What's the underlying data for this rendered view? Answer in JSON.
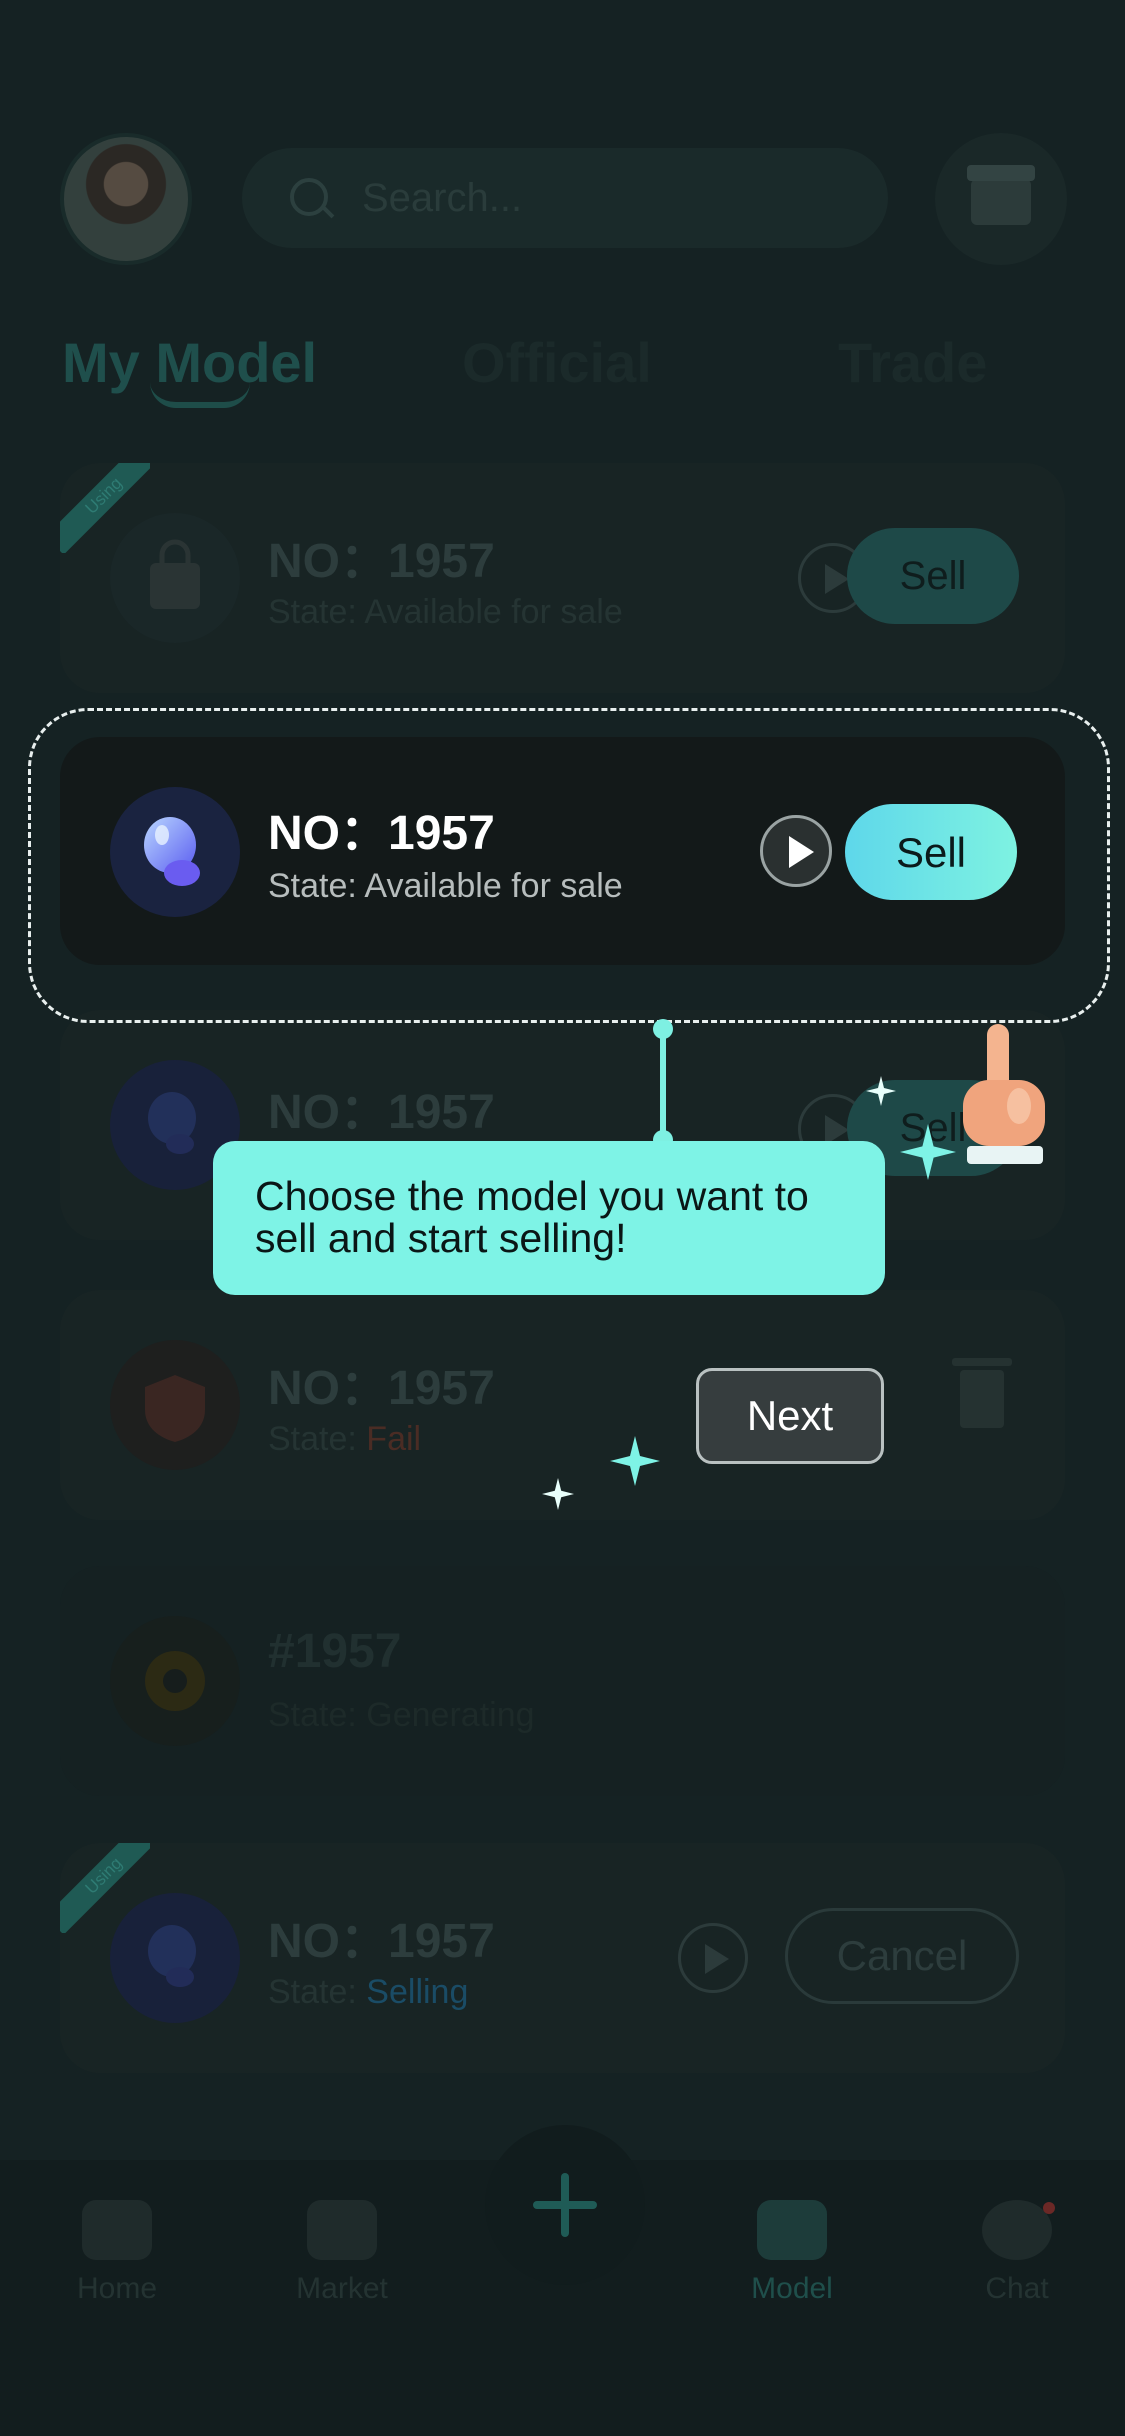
{
  "header": {
    "search_placeholder": "Search..."
  },
  "tabs": [
    {
      "label": "My Model"
    },
    {
      "label": "Official"
    },
    {
      "label": "Trade"
    }
  ],
  "cards": [
    {
      "badge": "Using",
      "number": "NO：1957",
      "state_prefix": "State:",
      "state_value": "Available for sale",
      "action": "Sell"
    },
    {
      "number": "NO：1957",
      "state_prefix": "State:",
      "state_value": "Available for sale",
      "action": "Sell"
    },
    {
      "number": "NO：1957",
      "action": "Sell"
    },
    {
      "number": "NO：1957",
      "state_prefix": "State:",
      "state_value": "Fail"
    },
    {
      "number": "#1957",
      "state_prefix": "State:",
      "state_value": "Generating"
    },
    {
      "badge": "Using",
      "number": "NO：1957",
      "state_prefix": "State:",
      "state_value": "Selling",
      "action": "Cancel"
    }
  ],
  "highlight": {
    "number": "NO：1957",
    "state": "State: Available for sale",
    "action": "Sell"
  },
  "tooltip": {
    "text": "Choose the model you want to sell and start selling!",
    "next_label": "Next"
  },
  "bottom_nav": [
    {
      "label": "Home"
    },
    {
      "label": "Market"
    },
    {
      "label": "Model",
      "active": true
    },
    {
      "label": "Chat"
    }
  ],
  "colors": {
    "accent": "#7ef3e6",
    "sell_gradient_start": "#5ed7ea",
    "sell_gradient_end": "#7ef2e1",
    "selling_state": "#1a4c66",
    "fail_state": "#4a2c24"
  }
}
